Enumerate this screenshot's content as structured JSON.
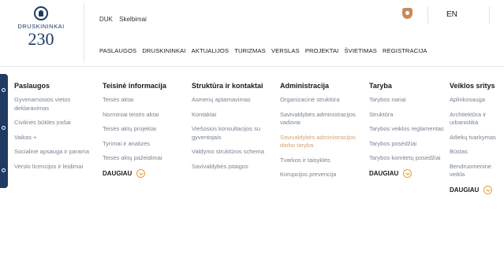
{
  "header": {
    "logo": {
      "name": "DRUSKININKAI",
      "number": "230"
    },
    "top_links": [
      "DUK",
      "Skelbimai"
    ],
    "language": "EN",
    "nav": [
      "PASLAUGOS",
      "DRUSKININKAI",
      "AKTUALIJOS",
      "TURIZMAS",
      "VERSLAS",
      "PROJEKTAI",
      "ŠVIETIMAS",
      "REGISTRACIJA"
    ]
  },
  "menu": {
    "more_label": "DAUGIAU",
    "columns": [
      {
        "title": "Paslaugos",
        "items": [
          "Gyvenamosios vietos deklaravimas",
          "Civilinės būklės įrašai",
          "Vaikas +",
          "Socialinė apsauga ir parama",
          "Verslo licencijos ir leidimai"
        ]
      },
      {
        "title": "Teisinė informacija",
        "items": [
          "Teisės aktai",
          "Norminiai teisės aktai",
          "Teisės aktų projektai",
          "Tyrimai ir analizės",
          "Teisės aktų pažeidimai"
        ]
      },
      {
        "title": "Struktūra ir kontaktai",
        "items": [
          "Asmenų aptarnavimas",
          "Kontaktai",
          "Viešosios konsultacijos su gyventojais",
          "Valdymo struktūros schema",
          "Savivaldybės įstaigos"
        ]
      },
      {
        "title": "Administracija",
        "items": [
          "Organizacinė struktūra",
          "Savivaldybės administracijos vadovai",
          "Savivaldybės administracijos darbo taryba",
          "Tvarkos ir taisyklės",
          "Korupcijos prevencija"
        ]
      },
      {
        "title": "Taryba",
        "items": [
          "Tarybos nariai",
          "Struktūra",
          "Tarybos veiklos reglamentas",
          "Tarybos posėdžiai",
          "Tarybos komitetų posėdžiai"
        ]
      },
      {
        "title": "Veiklos sritys",
        "items": [
          "Aplinkosauga",
          "Architektūra ir urbanistika",
          "Atliekų tvarkymas",
          "Būstas",
          "Bendruomeninė veikla"
        ]
      }
    ]
  },
  "colors": {
    "brand": "#1f3a63",
    "accent": "#e3a030",
    "muted_text": "#7a8390",
    "highlight_text": "#d4a373"
  }
}
